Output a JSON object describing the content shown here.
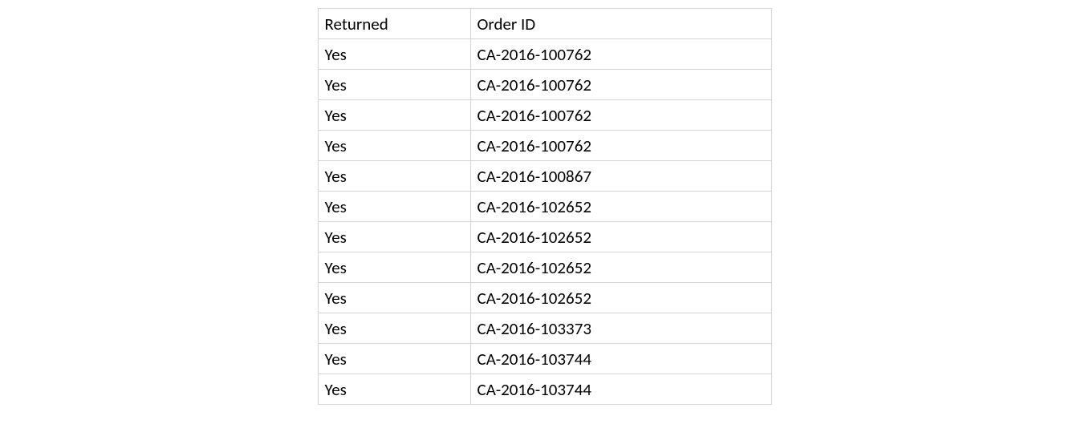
{
  "table": {
    "headers": {
      "returned": "Returned",
      "order_id": "Order ID"
    },
    "rows": [
      {
        "returned": "Yes",
        "order_id": "CA-2016-100762"
      },
      {
        "returned": "Yes",
        "order_id": "CA-2016-100762"
      },
      {
        "returned": "Yes",
        "order_id": "CA-2016-100762"
      },
      {
        "returned": "Yes",
        "order_id": "CA-2016-100762"
      },
      {
        "returned": "Yes",
        "order_id": "CA-2016-100867"
      },
      {
        "returned": "Yes",
        "order_id": "CA-2016-102652"
      },
      {
        "returned": "Yes",
        "order_id": "CA-2016-102652"
      },
      {
        "returned": "Yes",
        "order_id": "CA-2016-102652"
      },
      {
        "returned": "Yes",
        "order_id": "CA-2016-102652"
      },
      {
        "returned": "Yes",
        "order_id": "CA-2016-103373"
      },
      {
        "returned": "Yes",
        "order_id": "CA-2016-103744"
      },
      {
        "returned": "Yes",
        "order_id": "CA-2016-103744"
      }
    ]
  }
}
